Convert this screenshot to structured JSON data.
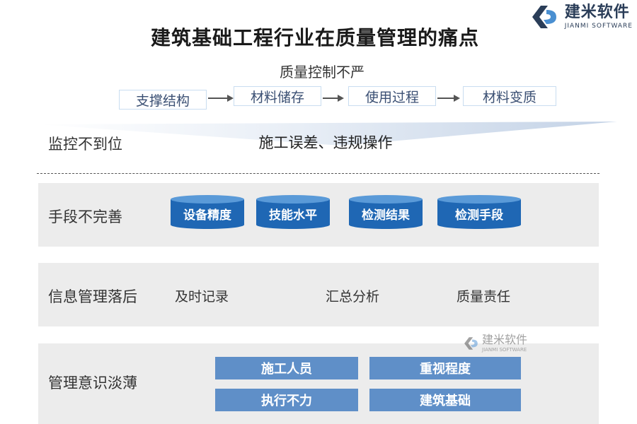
{
  "logo": {
    "name": "建米软件",
    "subtitle": "JIANMI SOFTWARE",
    "colors": {
      "dark": "#2a3d58",
      "accent": "#4a8fd1"
    }
  },
  "title": "建筑基础工程行业在质量管理的痛点",
  "quality_control": {
    "heading": "质量控制不严",
    "steps": [
      "支撑结构",
      "材料储存",
      "使用过程",
      "材料变质"
    ]
  },
  "monitoring": {
    "label": "监控不到位",
    "detail": "施工误差、违规操作"
  },
  "means": {
    "label": "手段不完善",
    "items": [
      "设备精度",
      "技能水平",
      "检测结果",
      "检测手段"
    ]
  },
  "info_management": {
    "label": "信息管理落后",
    "items": [
      "及时记录",
      "汇总分析",
      "质量责任"
    ]
  },
  "awareness": {
    "label": "管理意识淡薄",
    "items": [
      "施工人员",
      "重视程度",
      "执行不力",
      "建筑基础"
    ]
  },
  "watermark": {
    "name": "建米软件",
    "subtitle": "JIANMI SOFTWARE"
  },
  "colors": {
    "cylinder_fill": "#1f67b4",
    "cylinder_top": "#5a9ad8",
    "blue_box": "#5f8fc8",
    "panel_bg": "#ececec",
    "flow_border": "#c9ddf0"
  }
}
